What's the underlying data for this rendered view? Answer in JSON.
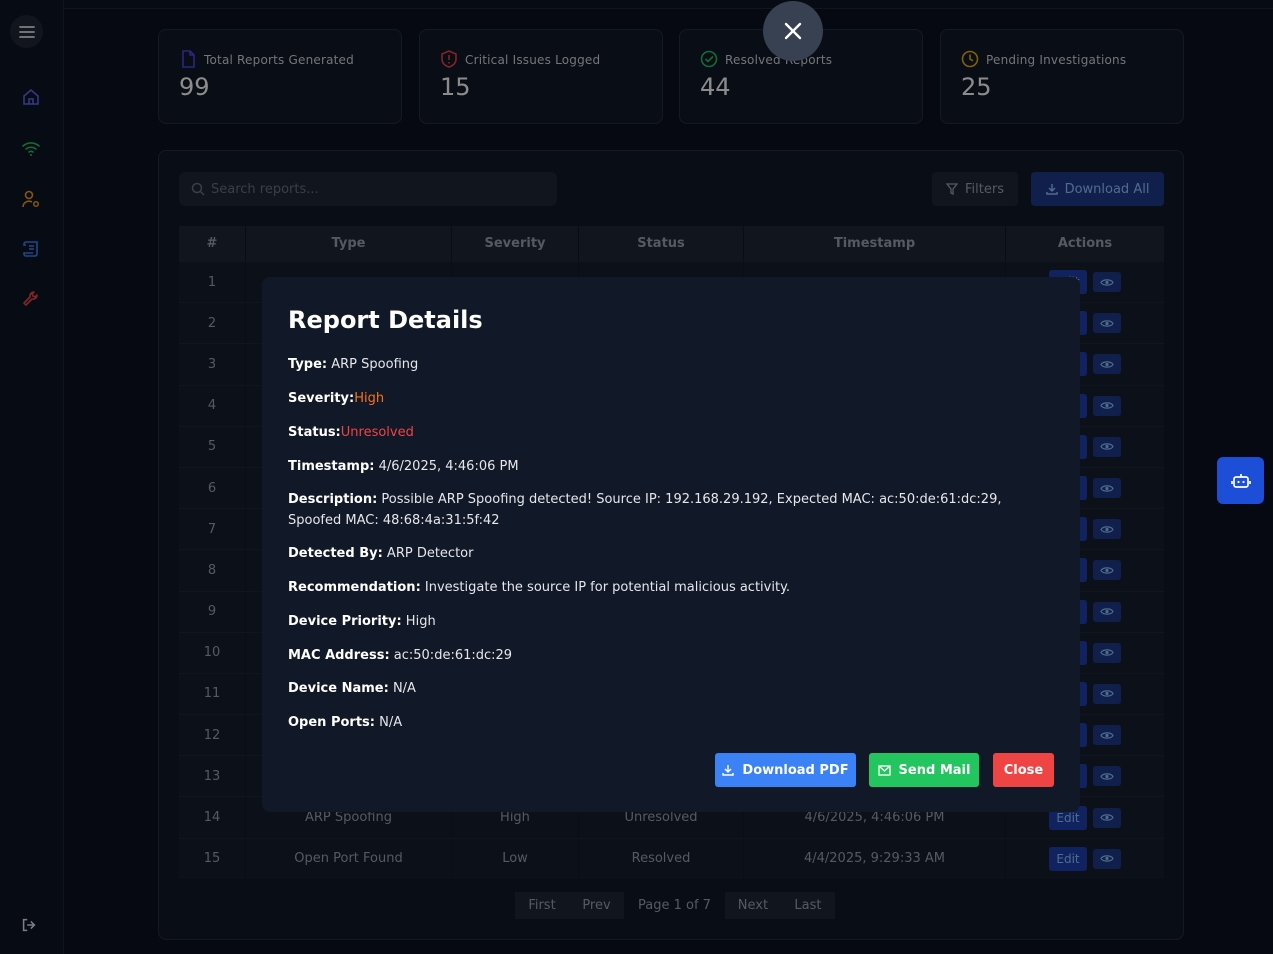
{
  "stats": [
    {
      "label": "Total Reports Generated",
      "value": "99",
      "icon": "file-icon",
      "color": "#4f46e5"
    },
    {
      "label": "Critical Issues Logged",
      "value": "15",
      "icon": "shield-alert-icon",
      "color": "#ef4444"
    },
    {
      "label": "Resolved Reports",
      "value": "44",
      "icon": "check-circle-icon",
      "color": "#22c55e"
    },
    {
      "label": "Pending Investigations",
      "value": "25",
      "icon": "clock-icon",
      "color": "#eab308"
    }
  ],
  "toolbar": {
    "search_placeholder": "Search reports...",
    "filters_label": "Filters",
    "download_all_label": "Download All"
  },
  "table": {
    "headers": [
      "#",
      "Type",
      "Severity",
      "Status",
      "Timestamp",
      "Actions"
    ],
    "rows": [
      {
        "n": "1",
        "type": "",
        "severity": "",
        "status": "",
        "timestamp": ""
      },
      {
        "n": "2",
        "type": "",
        "severity": "",
        "status": "",
        "timestamp": ""
      },
      {
        "n": "3",
        "type": "",
        "severity": "",
        "status": "",
        "timestamp": ""
      },
      {
        "n": "4",
        "type": "",
        "severity": "",
        "status": "",
        "timestamp": ""
      },
      {
        "n": "5",
        "type": "",
        "severity": "",
        "status": "",
        "timestamp": ""
      },
      {
        "n": "6",
        "type": "",
        "severity": "",
        "status": "",
        "timestamp": ""
      },
      {
        "n": "7",
        "type": "",
        "severity": "",
        "status": "",
        "timestamp": ""
      },
      {
        "n": "8",
        "type": "",
        "severity": "",
        "status": "",
        "timestamp": ""
      },
      {
        "n": "9",
        "type": "",
        "severity": "",
        "status": "",
        "timestamp": ""
      },
      {
        "n": "10",
        "type": "",
        "severity": "",
        "status": "",
        "timestamp": ""
      },
      {
        "n": "11",
        "type": "",
        "severity": "",
        "status": "",
        "timestamp": ""
      },
      {
        "n": "12",
        "type": "",
        "severity": "",
        "status": "",
        "timestamp": ""
      },
      {
        "n": "13",
        "type": "",
        "severity": "",
        "status": "",
        "timestamp": ""
      },
      {
        "n": "14",
        "type": "ARP Spoofing",
        "severity": "High",
        "status": "Unresolved",
        "timestamp": "4/6/2025, 4:46:06 PM"
      },
      {
        "n": "15",
        "type": "Open Port Found",
        "severity": "Low",
        "status": "Resolved",
        "timestamp": "4/4/2025, 9:29:33 AM"
      }
    ],
    "edit_label": "Edit"
  },
  "pagination": {
    "first": "First",
    "prev": "Prev",
    "page_text": "Page 1 of 7",
    "next": "Next",
    "last": "Last"
  },
  "modal": {
    "title": "Report Details",
    "fields": [
      {
        "label": "Type:",
        "value": " ARP Spoofing"
      },
      {
        "label": "Severity:",
        "value": "High"
      },
      {
        "label": "Status:",
        "value": "Unresolved"
      },
      {
        "label": "Timestamp:",
        "value": " 4/6/2025, 4:46:06 PM"
      },
      {
        "label": "Description:",
        "value": " Possible ARP Spoofing detected! Source IP: 192.168.29.192, Expected MAC: ac:50:de:61:dc:29, Spoofed MAC: 48:68:4a:31:5f:42"
      },
      {
        "label": "Detected By:",
        "value": " ARP Detector"
      },
      {
        "label": "Recommendation:",
        "value": " Investigate the source IP for potential malicious activity."
      },
      {
        "label": "Device Priority:",
        "value": " High"
      },
      {
        "label": "MAC Address:",
        "value": " ac:50:de:61:dc:29"
      },
      {
        "label": "Device Name:",
        "value": " N/A"
      },
      {
        "label": "Open Ports:",
        "value": " N/A"
      }
    ],
    "download_pdf": "Download PDF",
    "send_mail": "Send Mail",
    "close": "Close"
  },
  "colors": {
    "accent_blue": "#3b82f6",
    "green": "#22c55e",
    "red": "#ef4444"
  }
}
